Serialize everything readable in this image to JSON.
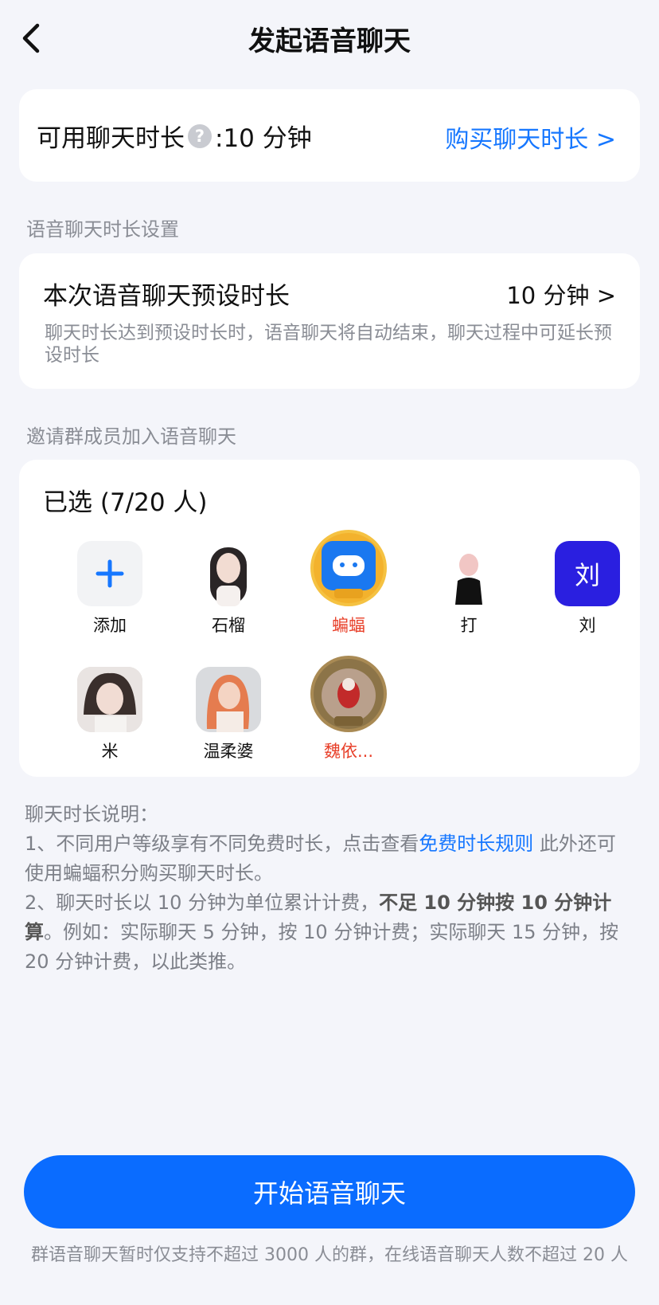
{
  "header": {
    "title": "发起语音聊天",
    "back_icon": "chevron-left-icon"
  },
  "available": {
    "label": "可用聊天时长",
    "help_icon": "question-icon",
    "value": ":10 分钟",
    "buy_link": "购买聊天时长 >"
  },
  "duration_section": {
    "label": "语音聊天时长设置",
    "title": "本次语音聊天预设时长",
    "value": "10 分钟 >",
    "desc": "聊天时长达到预设时长时，语音聊天将自动结束，聊天过程中可延长预设时长"
  },
  "members_section": {
    "label": "邀请群成员加入语音聊天",
    "selected": "已选 (7/20 人)",
    "add_label": "添加",
    "members": [
      {
        "name": "石榴",
        "red": false,
        "avatar_text": ""
      },
      {
        "name": "蝙蝠",
        "red": true,
        "avatar_text": ""
      },
      {
        "name": "打",
        "red": false,
        "avatar_text": ""
      },
      {
        "name": "刘",
        "red": false,
        "avatar_text": "刘"
      },
      {
        "name": "米",
        "red": false,
        "avatar_text": ""
      },
      {
        "name": "温柔婆",
        "red": false,
        "avatar_text": ""
      },
      {
        "name": "魏依...",
        "red": true,
        "avatar_text": ""
      }
    ]
  },
  "explain": {
    "title": "聊天时长说明：",
    "line1_a": "1、不同用户等级享有不同免费时长，点击查看",
    "line1_link": "免费时长规则",
    "line1_b": " 此外还可使用蝙蝠积分购买聊天时长。",
    "line2_a": "2、聊天时长以 10 分钟为单位累计计费，",
    "line2_bold": "不足 10 分钟按 10 分钟计算",
    "line2_b": "。例如：实际聊天 5 分钟，按 10 分钟计费；实际聊天 15 分钟，按 20 分钟计费，以此类推。"
  },
  "start_button": "开始语音聊天",
  "footer_note": "群语音聊天暂时仅支持不超过 3000 人的群，在线语音聊天人数不超过 20 人",
  "colors": {
    "accent": "#1677ff",
    "button": "#0a6cff",
    "red_name": "#e8402a",
    "liu_avatar": "#2a1fe0"
  }
}
